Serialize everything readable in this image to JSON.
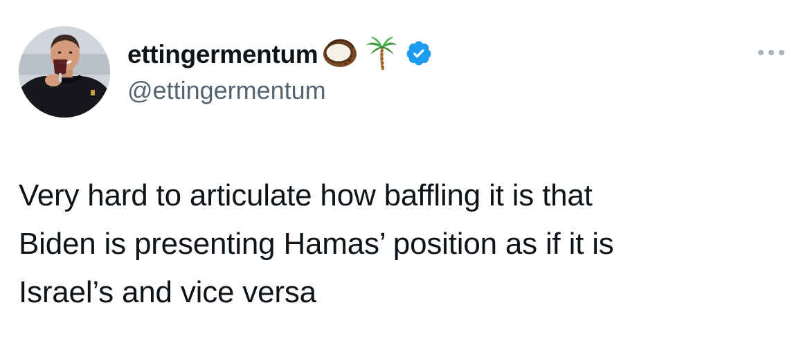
{
  "tweet": {
    "author": {
      "display_name": "ettingermentum",
      "handle": "@ettingermentum",
      "name_emojis": [
        "coconut-icon",
        "palm-tree-icon"
      ],
      "verified_badge_icon": "verified-badge-icon",
      "verified_color": "#1d9bf0"
    },
    "more_icon": "more-options-icon",
    "text": "Very hard to articulate how baffling it is that\nBiden is presenting Hamas’ position as if it is\nIsrael’s and vice versa"
  }
}
